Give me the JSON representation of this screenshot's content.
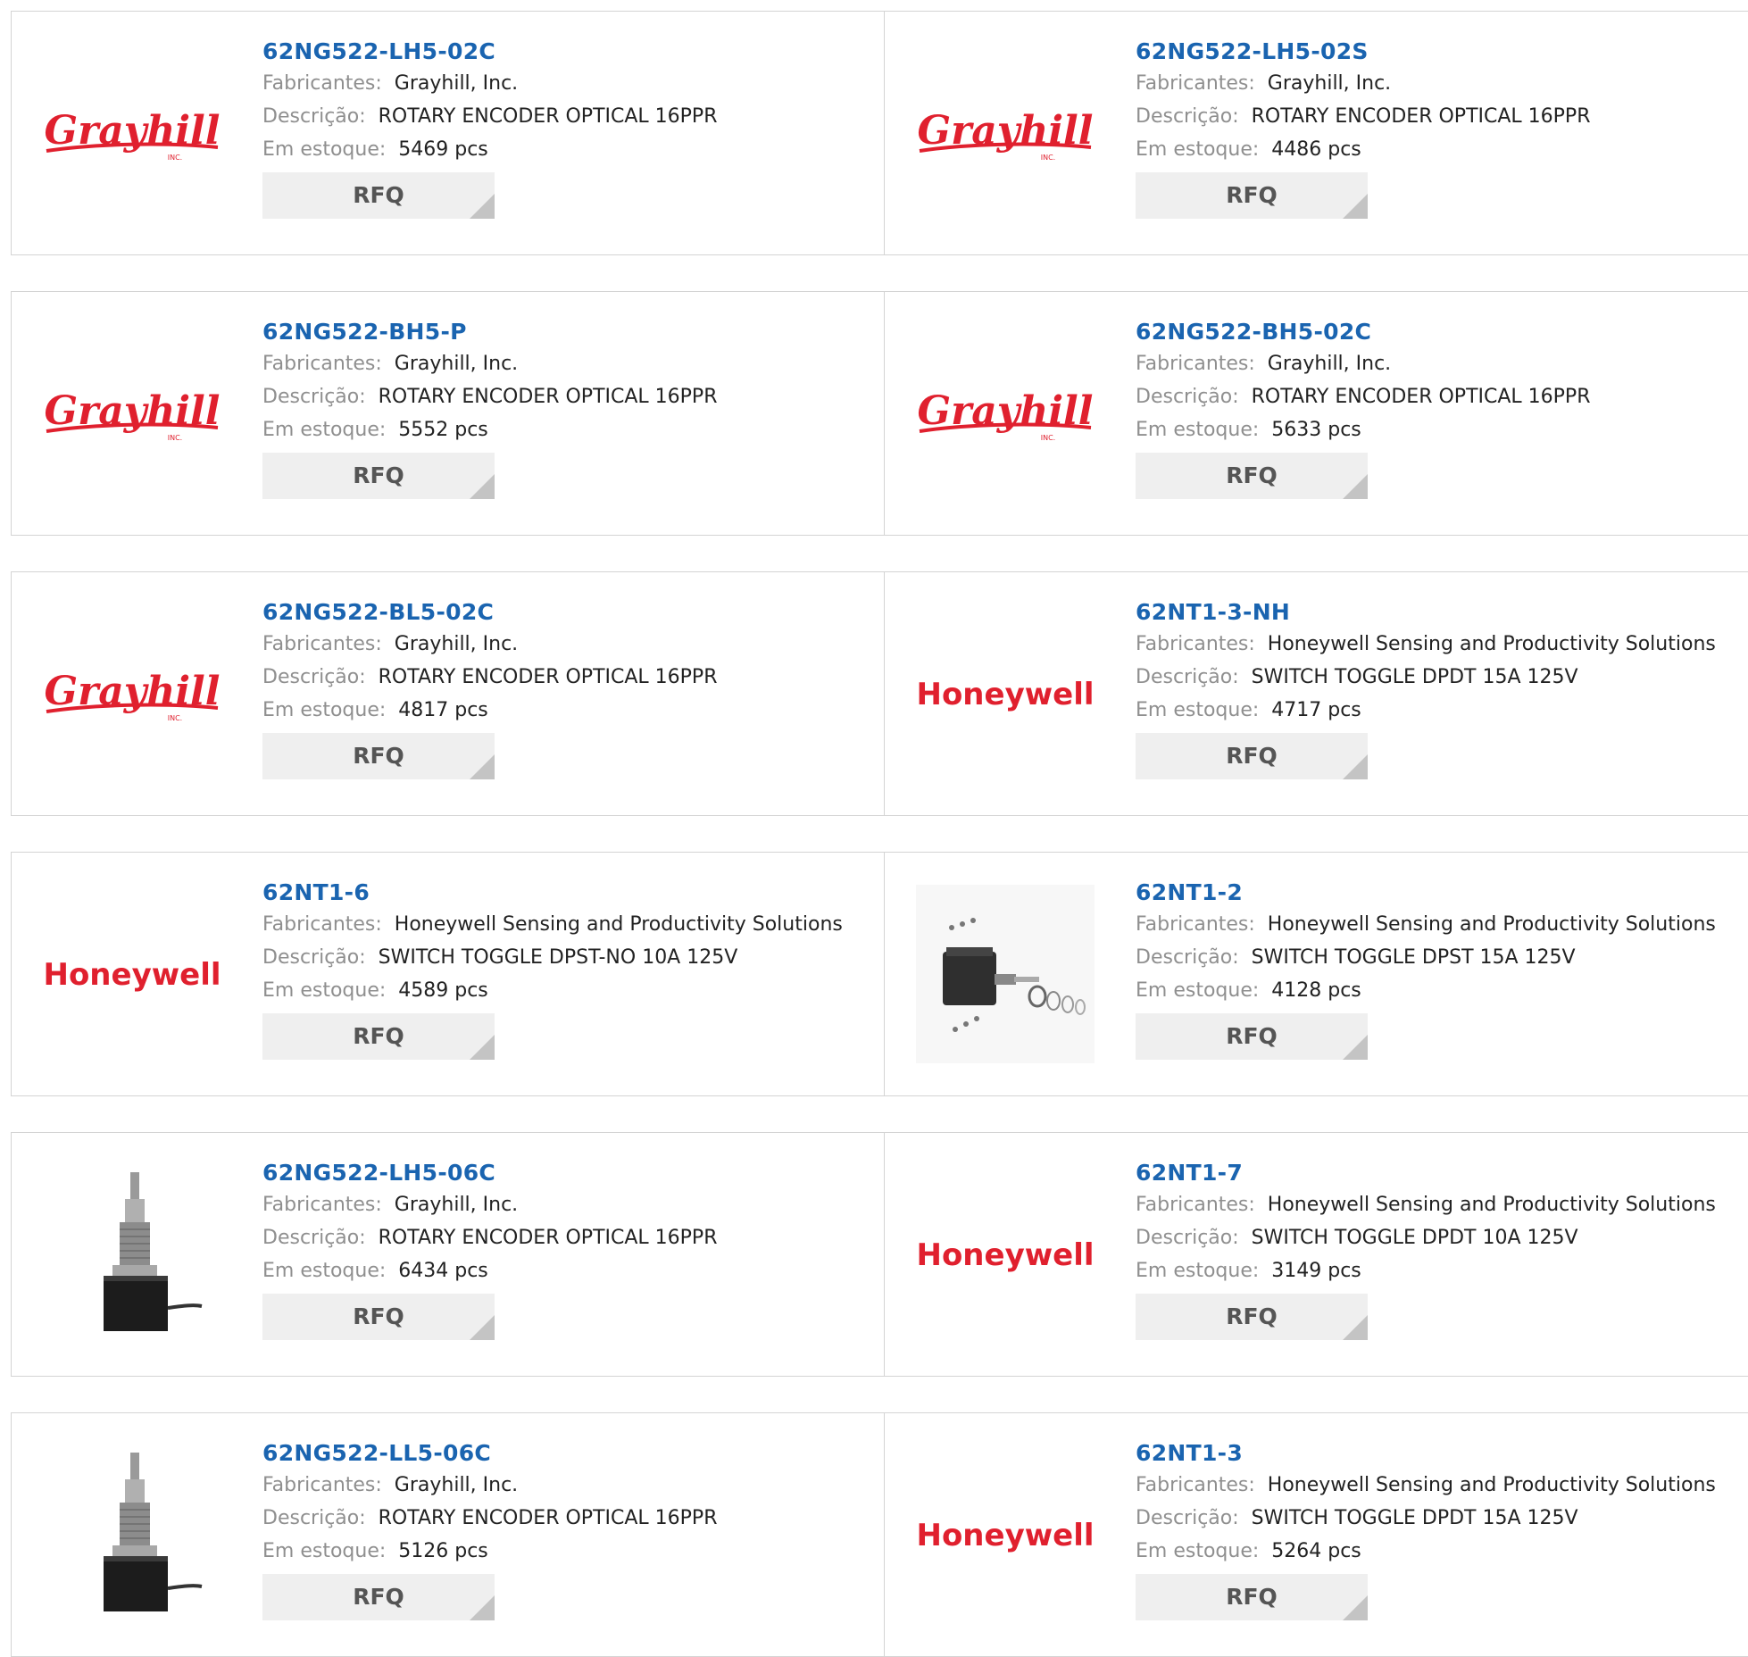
{
  "labels": {
    "manufacturer": "Fabricantes:",
    "description": "Descrição:",
    "stock": "Em estoque:",
    "rfq": "RFQ"
  },
  "brands": {
    "grayhill": {
      "logo_text": "Grayhill",
      "logo_subtext": "INC.",
      "color": "#e0202e"
    },
    "honeywell": {
      "logo_text": "Honeywell",
      "color": "#e0202e"
    }
  },
  "products": [
    {
      "part": "62NG522-LH5-02C",
      "manufacturer": "Grayhill, Inc.",
      "description": "ROTARY ENCODER OPTICAL 16PPR",
      "stock": "5469 pcs",
      "image": "grayhill-logo"
    },
    {
      "part": "62NG522-LH5-02S",
      "manufacturer": "Grayhill, Inc.",
      "description": "ROTARY ENCODER OPTICAL 16PPR",
      "stock": "4486 pcs",
      "image": "grayhill-logo"
    },
    {
      "part": "62NG522-BH5-P",
      "manufacturer": "Grayhill, Inc.",
      "description": "ROTARY ENCODER OPTICAL 16PPR",
      "stock": "5552 pcs",
      "image": "grayhill-logo"
    },
    {
      "part": "62NG522-BH5-02C",
      "manufacturer": "Grayhill, Inc.",
      "description": "ROTARY ENCODER OPTICAL 16PPR",
      "stock": "5633 pcs",
      "image": "grayhill-logo"
    },
    {
      "part": "62NG522-BL5-02C",
      "manufacturer": "Grayhill, Inc.",
      "description": "ROTARY ENCODER OPTICAL 16PPR",
      "stock": "4817 pcs",
      "image": "grayhill-logo"
    },
    {
      "part": "62NT1-3-NH",
      "manufacturer": "Honeywell Sensing and Productivity Solutions",
      "description": "SWITCH TOGGLE DPDT 15A 125V",
      "stock": "4717 pcs",
      "image": "honeywell-logo"
    },
    {
      "part": "62NT1-6",
      "manufacturer": "Honeywell Sensing and Productivity Solutions",
      "description": "SWITCH TOGGLE DPST-NO 10A 125V",
      "stock": "4589 pcs",
      "image": "honeywell-logo"
    },
    {
      "part": "62NT1-2",
      "manufacturer": "Honeywell Sensing and Productivity Solutions",
      "description": "SWITCH TOGGLE DPST 15A 125V",
      "stock": "4128 pcs",
      "image": "toggle-switch-photo"
    },
    {
      "part": "62NG522-LH5-06C",
      "manufacturer": "Grayhill, Inc.",
      "description": "ROTARY ENCODER OPTICAL 16PPR",
      "stock": "6434 pcs",
      "image": "encoder-photo"
    },
    {
      "part": "62NT1-7",
      "manufacturer": "Honeywell Sensing and Productivity Solutions",
      "description": "SWITCH TOGGLE DPDT 10A 125V",
      "stock": "3149 pcs",
      "image": "honeywell-logo"
    },
    {
      "part": "62NG522-LL5-06C",
      "manufacturer": "Grayhill, Inc.",
      "description": "ROTARY ENCODER OPTICAL 16PPR",
      "stock": "5126 pcs",
      "image": "encoder-photo"
    },
    {
      "part": "62NT1-3",
      "manufacturer": "Honeywell Sensing and Productivity Solutions",
      "description": "SWITCH TOGGLE DPDT 15A 125V",
      "stock": "5264 pcs",
      "image": "honeywell-logo"
    }
  ]
}
